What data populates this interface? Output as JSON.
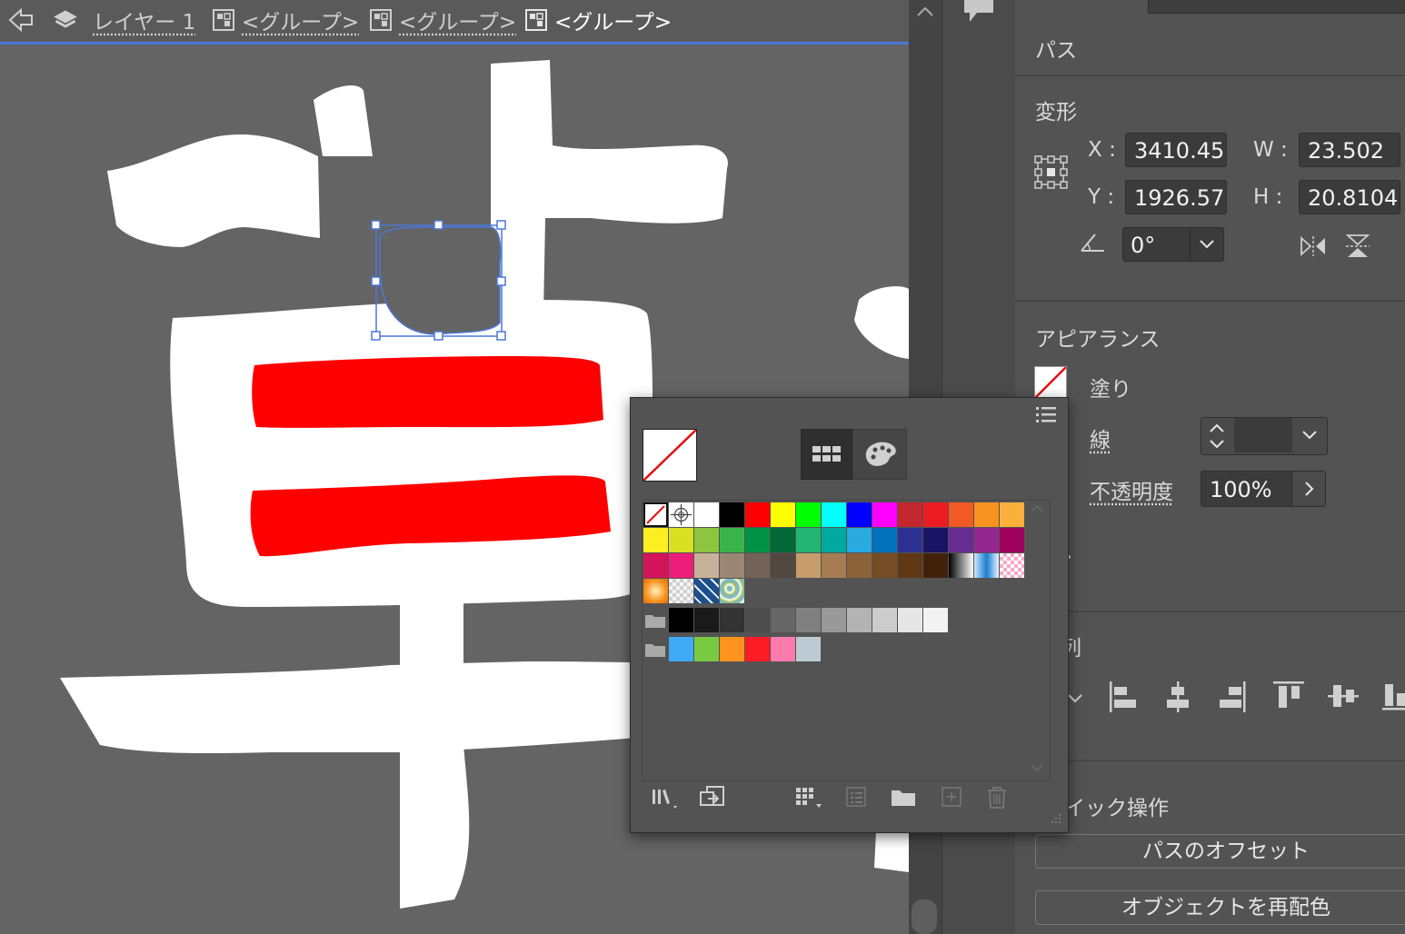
{
  "breadcrumb": {
    "back_icon": "back-arrow-icon",
    "layer_icon": "layers-icon",
    "layer_label": "レイヤー 1",
    "group_icon": "group-icon",
    "groups": [
      "<グループ>",
      "<グループ>",
      "<グループ>"
    ]
  },
  "canvas": {
    "glyph_color": "#ffffff",
    "stroke_color": "#ff0000",
    "selection_color": "#4a78d8"
  },
  "panel": {
    "path_title": "パス",
    "transform": {
      "title": "変形",
      "reference_point_icon": "reference-point-icon",
      "x_label": "X :",
      "x_value": "3410.45",
      "y_label": "Y :",
      "y_value": "1926.57",
      "w_label": "W :",
      "w_value": "23.502",
      "h_label": "H :",
      "h_value": "20.8104",
      "angle_icon": "angle-icon",
      "angle_value": "0°",
      "flip_h_icon": "flip-horizontal-icon",
      "flip_v_icon": "flip-vertical-icon"
    },
    "appearance": {
      "title": "アピアランス",
      "fill_label": "塗り",
      "stroke_label": "線",
      "opacity_label": "不透明度",
      "opacity_value": "100%"
    },
    "align_title_partial": "列",
    "quick_actions_title_partial": "イック操作",
    "offset_button": "パスのオフセット",
    "recolor_button": "オブジェクトを再配色"
  },
  "swatch_panel": {
    "current": "none",
    "view_icons": [
      "swatch-view-icon",
      "color-palette-icon"
    ],
    "swatch_rows": [
      [
        "none",
        "registration",
        "#ffffff",
        "#000000",
        "#ff0000",
        "#ffff00",
        "#00ff00",
        "#00ffff",
        "#0000ff",
        "#ff00ff",
        "#c1272d",
        "#ed1c24",
        "#f15a24",
        "#f7931e",
        "#fbb03b"
      ],
      [
        "#fcee21",
        "#d9e021",
        "#8cc63f",
        "#39b54a",
        "#009245",
        "#006837",
        "#22b573",
        "#00a99d",
        "#29abe2",
        "#0071bc",
        "#2e3192",
        "#1b1464",
        "#662d91",
        "#93278f",
        "#9e005d"
      ],
      [
        "#d4145a",
        "#ed1e79",
        "#c7b299",
        "#998675",
        "#736357",
        "#534741",
        "#c69c6d",
        "#a67c52",
        "#8c6239",
        "#754c24",
        "#603813",
        "#42210b",
        "gradient-bw",
        "gradient-blue",
        "pattern-pink"
      ],
      [
        "gradient-orange",
        "pattern-checker",
        "pattern-blue",
        "pattern-floral"
      ]
    ],
    "gray_group": [
      "#000000",
      "#1a1a1a",
      "#333333",
      "#4d4d4d",
      "#666666",
      "#808080",
      "#999999",
      "#b3b3b3",
      "#cccccc",
      "#e6e6e6",
      "#f2f2f2"
    ],
    "color_group": [
      "#3fa9f5",
      "#7ac943",
      "#ff931e",
      "#ff1d25",
      "#ff7bac",
      "#bdccd4"
    ],
    "folder_icon": "folder-icon",
    "toolbar_icons": [
      "swatch-libraries-icon",
      "place-swatch-icon",
      "show-kinds-icon",
      "swatch-options-icon",
      "new-color-group-icon",
      "new-swatch-icon",
      "delete-swatch-icon"
    ]
  }
}
